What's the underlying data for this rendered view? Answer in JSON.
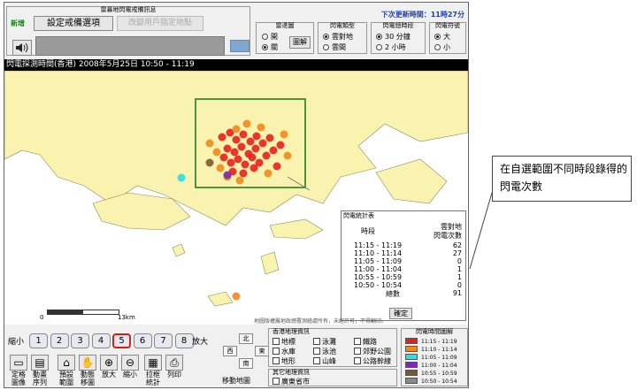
{
  "warning_panel": {
    "title": "雷暴地閃電戒備訊息",
    "new_badge": "新增",
    "settings_button": "設定戒備選項",
    "change_location_button": "改變用戶指定地點"
  },
  "update_time": "下次更新時間：11時27分",
  "radar_map": {
    "title": "雷達圖",
    "options": [
      "開",
      "關"
    ],
    "selected": "關"
  },
  "legend_button": "圖解",
  "lightning_type": {
    "title": "閃電類型",
    "options": [
      "雲對地",
      "雲間"
    ],
    "selected": "雲對地"
  },
  "period": {
    "title": "閃電總時段",
    "options": [
      "30 分鐘",
      "2 小時"
    ],
    "selected": "30 分鐘"
  },
  "symbol": {
    "title": "閃電符號",
    "options": [
      "大",
      "小"
    ],
    "selected": "大"
  },
  "map_title": "閃電探測時間(香港) 2008年5月25日 10:50 - 11:19",
  "stats": {
    "caption": "閃電統計表",
    "period_header": "時段",
    "count_header_1": "雲對地",
    "count_header_2": "閃電次數",
    "rows": [
      {
        "period": "11:15 - 11:19",
        "count": "62"
      },
      {
        "period": "11:10 - 11:14",
        "count": "27"
      },
      {
        "period": "11:05 - 11:09",
        "count": "0"
      },
      {
        "period": "11:00 - 11:04",
        "count": "1"
      },
      {
        "period": "10:55 - 10:59",
        "count": "1"
      },
      {
        "period": "10:50 - 10:54",
        "count": "0"
      }
    ],
    "total_label": "總數",
    "total": "91",
    "ok_button": "確定"
  },
  "scale": {
    "start": "0",
    "end": "13km"
  },
  "copyright": "地圖版權屬地政總署測繪處所有，未經許可，不得翻印。",
  "zoom": {
    "out_label": "縮小",
    "in_label": "放大",
    "levels": [
      "1",
      "2",
      "3",
      "4",
      "5",
      "6",
      "7",
      "8"
    ],
    "active_level": "5"
  },
  "tools": [
    {
      "name": "fixed-image",
      "label": "定格\n圖像"
    },
    {
      "name": "animation",
      "label": "動畫\n序列"
    },
    {
      "name": "default-view",
      "label": "預設\n範圍"
    },
    {
      "name": "pan",
      "label": "動態\n移圖"
    },
    {
      "name": "zoom-in",
      "label": "放大"
    },
    {
      "name": "zoom-out",
      "label": "縮小"
    },
    {
      "name": "box-stats",
      "label": "拉框\n統計"
    },
    {
      "name": "print",
      "label": "列印"
    }
  ],
  "move_map": {
    "label": "移動地圖",
    "north": "北",
    "south": "南",
    "east": "東",
    "west": "西"
  },
  "geo_info": {
    "title": "香港地理資訊",
    "items": [
      "地標",
      "泳灘",
      "鐵路",
      "水庫",
      "泳池",
      "郊野公園",
      "地形",
      "山峰",
      "公路幹線"
    ]
  },
  "other_geo": {
    "title": "其它地理資訊",
    "items": [
      "廣東省市"
    ]
  },
  "time_legend": {
    "title": "閃電時間圖解",
    "entries": [
      {
        "label": "11:15 - 11:19",
        "color": "#e8201c"
      },
      {
        "label": "11:10 - 11:14",
        "color": "#f08a1c"
      },
      {
        "label": "11:05 - 11:09",
        "color": "#28e0e8"
      },
      {
        "label": "11:00 - 11:04",
        "color": "#7a2ab0"
      },
      {
        "label": "10:55 - 10:59",
        "color": "#7b5a2a"
      },
      {
        "label": "10:50 - 10:54",
        "color": "#8a8a8a"
      }
    ]
  },
  "annotation": "在自選範圍不同時段錄得的閃電次數"
}
